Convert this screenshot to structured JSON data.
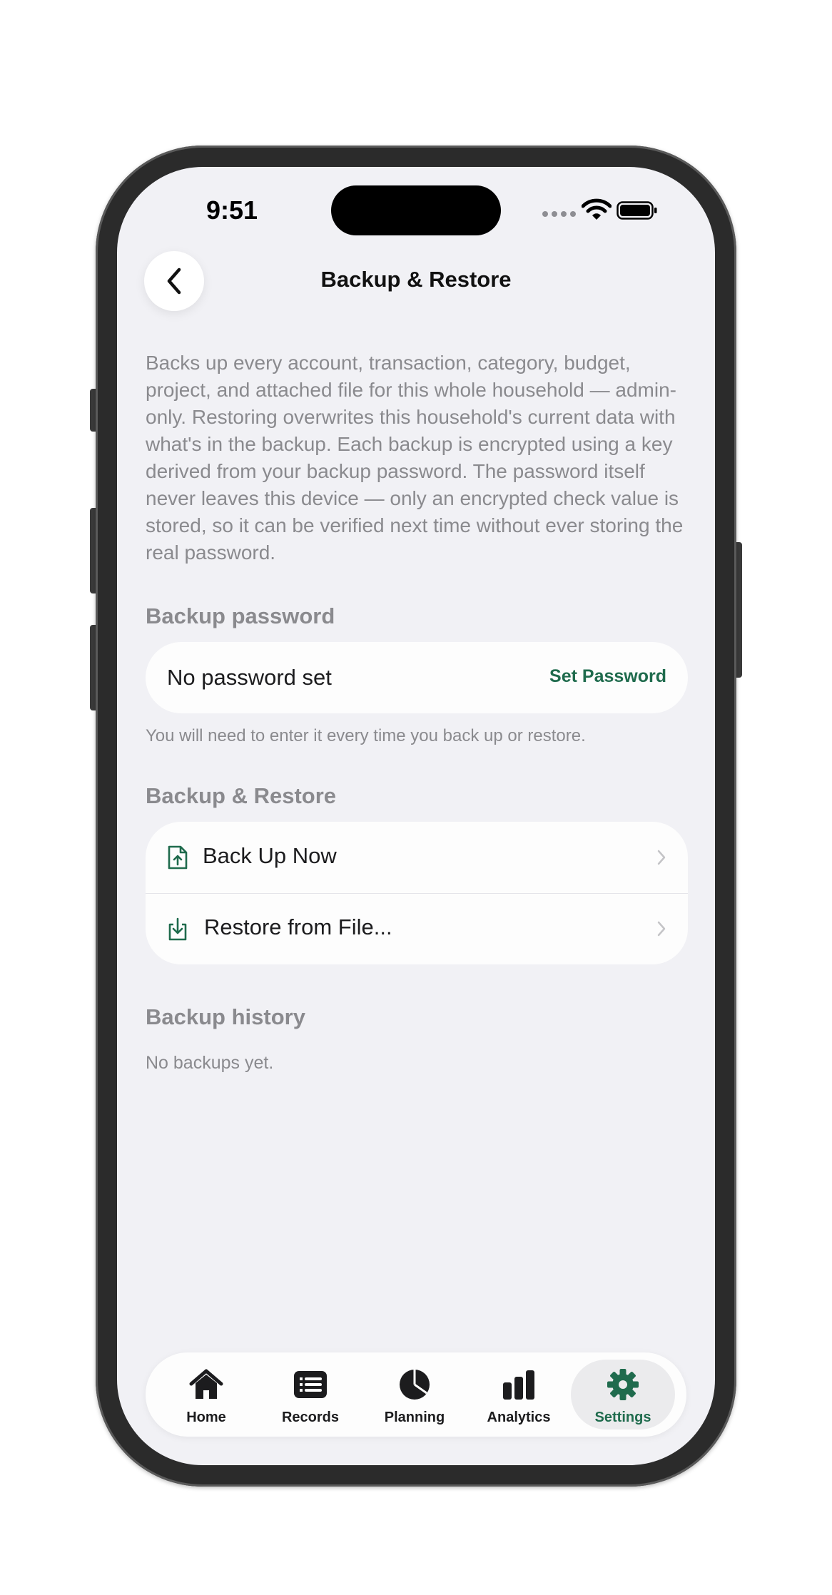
{
  "status_bar": {
    "time": "9:51"
  },
  "nav": {
    "title": "Backup & Restore",
    "back_icon": "chevron-left-icon"
  },
  "description": "Backs up every account, transaction, category, budget, project, and attached file for this whole household — admin-only. Restoring overwrites this household's current data with what's in the backup. Each backup is encrypted using a key derived from your backup password. The password itself never leaves this device — only an encrypted check value is stored, so it can be verified next time without ever storing the real password.",
  "password_section": {
    "header": "Backup password",
    "status": "No password set",
    "action": "Set Password",
    "footnote": "You will need to enter it every time you back up or restore."
  },
  "backup_section": {
    "header": "Backup & Restore",
    "items": [
      {
        "label": "Back Up Now",
        "icon": "file-upload-icon"
      },
      {
        "label": "Restore from File...",
        "icon": "download-tray-icon"
      }
    ]
  },
  "history_section": {
    "header": "Backup history",
    "empty": "No backups yet."
  },
  "tabbar": {
    "tabs": [
      {
        "label": "Home",
        "icon": "house-icon"
      },
      {
        "label": "Records",
        "icon": "list-icon"
      },
      {
        "label": "Planning",
        "icon": "pie-chart-icon"
      },
      {
        "label": "Analytics",
        "icon": "bar-chart-icon"
      },
      {
        "label": "Settings",
        "icon": "gear-icon"
      }
    ],
    "active": "Settings"
  },
  "colors": {
    "accent": "#1f6b4d",
    "background": "#f1f1f5",
    "secondary_text": "#8a8a8e"
  }
}
